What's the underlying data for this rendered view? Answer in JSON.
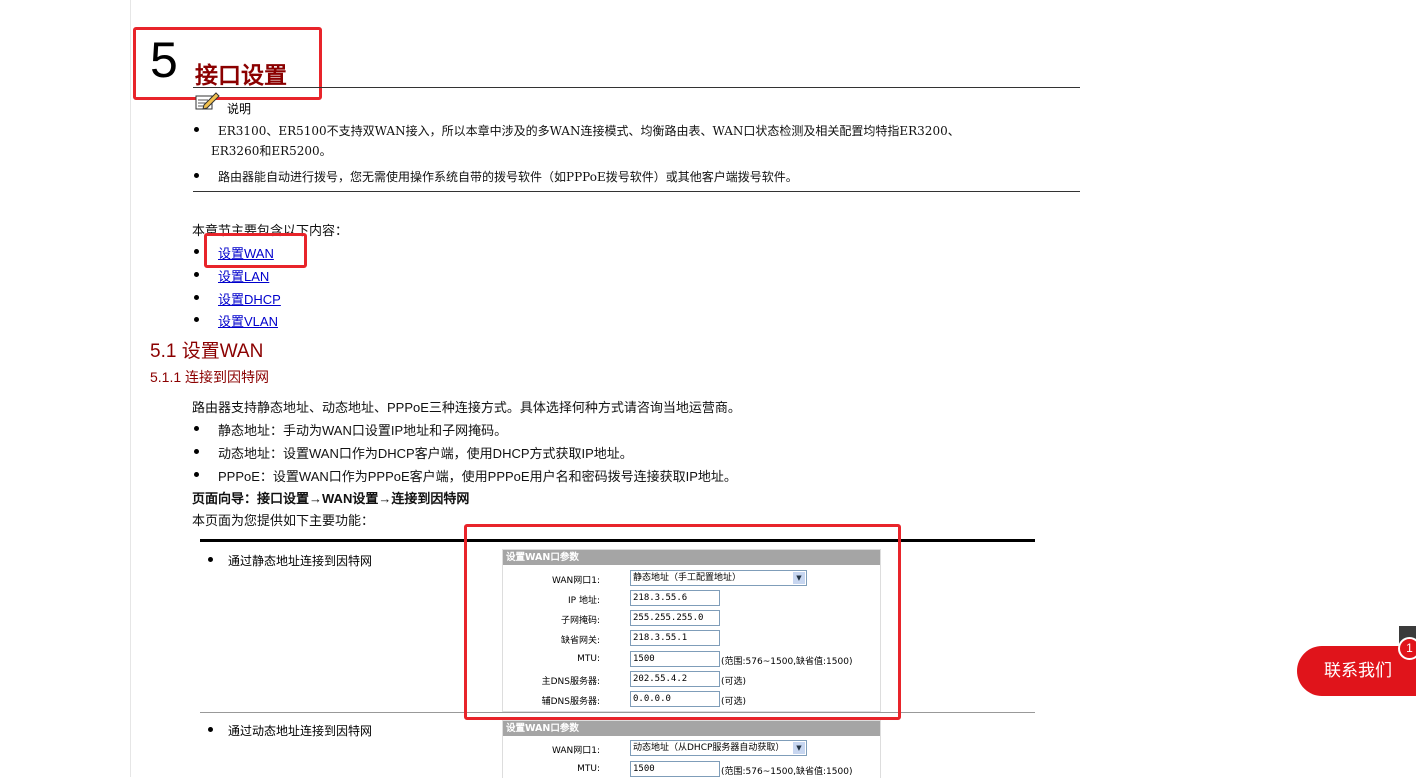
{
  "chapter": {
    "number": "5",
    "title": "接口设置"
  },
  "note": {
    "label": "说明",
    "items": [
      "ER3100、ER5100不支持双WAN接入，所以本章中涉及的多WAN连接模式、均衡路由表、WAN口状态检测及相关配置均特指ER3200、",
      "ER3260和ER5200。",
      "路由器能自动进行拨号，您无需使用操作系统自带的拨号软件（如PPPoE拨号软件）或其他客户端拨号软件。"
    ]
  },
  "toc": {
    "intro": "本章节主要包含以下内容：",
    "links": [
      "设置WAN",
      "设置LAN",
      "设置DHCP",
      "设置VLAN"
    ]
  },
  "section": {
    "title": "5.1  设置WAN",
    "subsection": "5.1.1  连接到因特网",
    "intro": "路由器支持静态地址、动态地址、PPPoE三种连接方式。具体选择何种方式请咨询当地运营商。",
    "bullets": [
      "静态地址：手动为WAN口设置IP地址和子网掩码。",
      "动态地址：设置WAN口作为DHCP客户端，使用DHCP方式获取IP地址。",
      "PPPoE：设置WAN口作为PPPoE客户端，使用PPPoE用户名和密码拨号连接获取IP地址。"
    ],
    "nav": "页面向导：接口设置→WAN设置→连接到因特网",
    "features_intro": "本页面为您提供如下主要功能："
  },
  "features": [
    {
      "label": "通过静态地址连接到因特网",
      "panel": {
        "header": "设置WAN口参数",
        "wan_label": "WAN网口1:",
        "wan_value": "静态地址（手工配置地址）",
        "fields": [
          {
            "label": "IP 地址:",
            "value": "218.3.55.6",
            "hint": ""
          },
          {
            "label": "子网掩码:",
            "value": "255.255.255.0",
            "hint": ""
          },
          {
            "label": "缺省网关:",
            "value": "218.3.55.1",
            "hint": ""
          },
          {
            "label": "MTU:",
            "value": "1500",
            "hint": "(范围:576~1500,缺省值:1500)"
          },
          {
            "label": "主DNS服务器:",
            "value": "202.55.4.2",
            "hint": "(可选)"
          },
          {
            "label": "辅DNS服务器:",
            "value": "0.0.0.0",
            "hint": "(可选)"
          }
        ]
      }
    },
    {
      "label": "通过动态地址连接到因特网",
      "panel": {
        "header": "设置WAN口参数",
        "wan_label": "WAN网口1:",
        "wan_value": "动态地址（从DHCP服务器自动获取）",
        "fields": [
          {
            "label": "MTU:",
            "value": "1500",
            "hint": "(范围:576~1500,缺省值:1500)"
          }
        ]
      }
    }
  ],
  "contact": {
    "label": "联系我们",
    "badge": "1"
  },
  "colors": {
    "accent_red": "#e8242a",
    "title_dark_red": "#8b0000",
    "link_blue": "#0000cc"
  }
}
